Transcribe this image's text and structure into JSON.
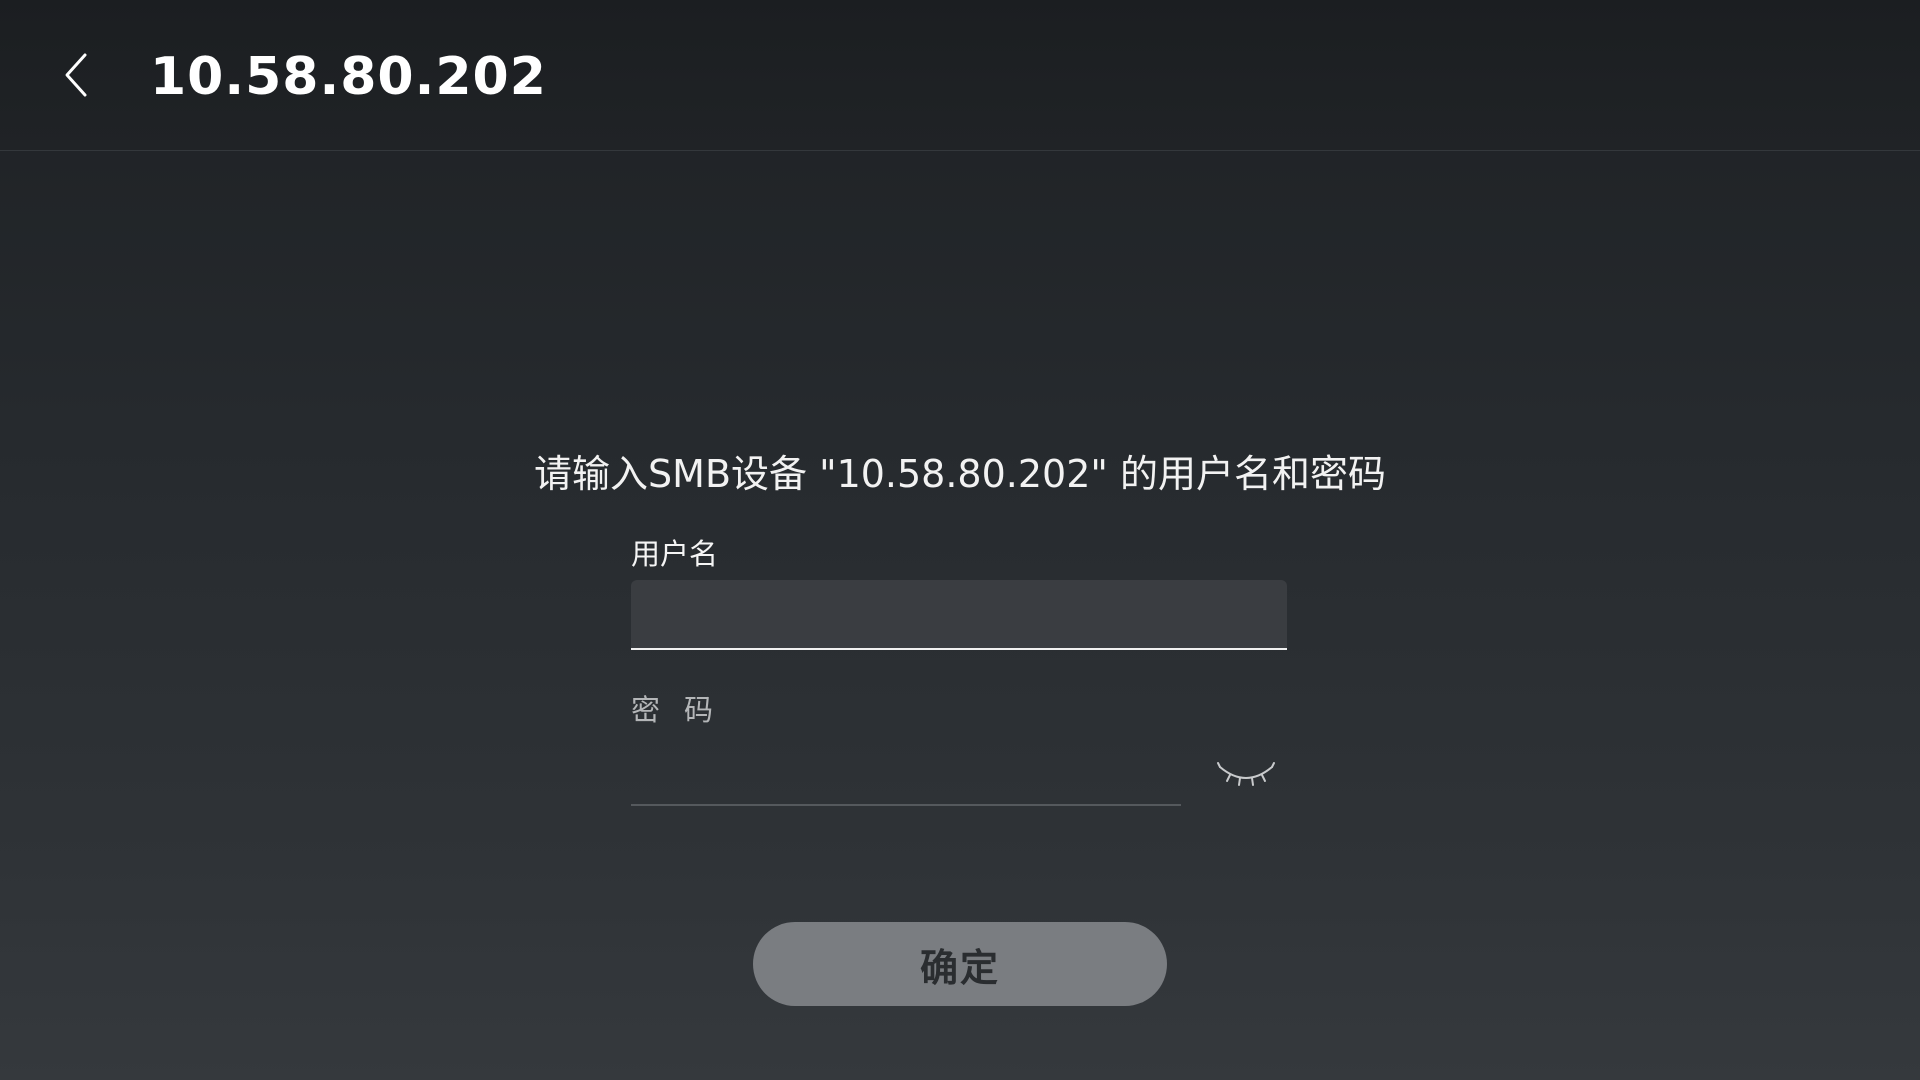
{
  "header": {
    "title": "10.58.80.202",
    "back_icon": "chevron-left-icon"
  },
  "prompt": "请输入SMB设备 \"10.58.80.202\" 的用户名和密码",
  "form": {
    "username_label": "用户名",
    "username_value": "",
    "password_label": "密码",
    "password_value": "",
    "password_toggle_icon": "eye-closed-icon"
  },
  "confirm_label": "确定",
  "colors": {
    "background": "#2a2e32",
    "header": "#1e2124",
    "input_fill": "#3a3d41",
    "button": "#7a7d81",
    "button_text": "#2a2d30"
  }
}
